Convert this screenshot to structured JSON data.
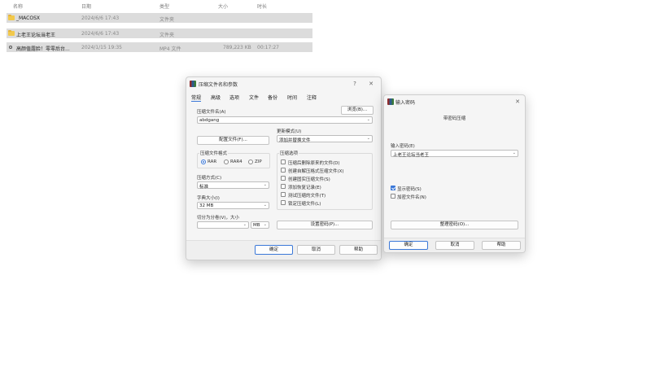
{
  "file_list": {
    "columns": {
      "name": "名称",
      "date": "日期",
      "type": "类型",
      "size": "大小",
      "duration": "时长"
    },
    "rows": [
      {
        "icon": "folder-icon",
        "name": "_MACOSX",
        "date": "2024/6/6 17:43",
        "type": "文件夹",
        "size": "",
        "duration": ""
      },
      {
        "icon": "folder-icon",
        "name": "上老王论坛当老王",
        "date": "2024/6/6 17:43",
        "type": "文件夹",
        "size": "",
        "duration": ""
      },
      {
        "icon": "media-icon",
        "name": "高颜值露脸！零零后台...",
        "date": "2024/1/15 19:35",
        "type": "MP4 文件",
        "size": "789,223 KB",
        "duration": "00:17:27"
      }
    ]
  },
  "archive_dialog": {
    "title": "压缩文件名和参数",
    "help_glyph": "?",
    "close_glyph": "✕",
    "tabs": [
      "常规",
      "高级",
      "选项",
      "文件",
      "备份",
      "时间",
      "注释"
    ],
    "archive_name_label": "压缩文件名(A)",
    "archive_name_value": "abdgang",
    "browse_label": "浏览(B)...",
    "update_mode_label": "更新模式(U)",
    "update_mode_value": "添加并替换文件",
    "profiles_label": "配置文件(F)...",
    "format_group": "压缩文件格式",
    "formats": [
      "RAR",
      "RAR4",
      "ZIP"
    ],
    "format_selected": "RAR",
    "method_label": "压缩方式(C)",
    "method_value": "标准",
    "dict_label": "字典大小(I)",
    "dict_value": "32 MB",
    "split_label": "切分为分卷(V)，大小",
    "split_value": "",
    "split_unit": "MB",
    "options_group": "压缩选项",
    "options": [
      {
        "label": "压缩后删除原来的文件(D)",
        "checked": false
      },
      {
        "label": "创建自解压格式压缩文件(X)",
        "checked": false
      },
      {
        "label": "创建固实压缩文件(S)",
        "checked": false
      },
      {
        "label": "添加恢复记录(E)",
        "checked": false
      },
      {
        "label": "测试压缩的文件(T)",
        "checked": false
      },
      {
        "label": "锁定压缩文件(L)",
        "checked": false
      }
    ],
    "set_password_label": "设置密码(P)...",
    "ok_label": "确定",
    "cancel_label": "取消",
    "help_label": "帮助"
  },
  "password_dialog": {
    "title": "输入密码",
    "close_glyph": "✕",
    "subtitle": "带密码压缩",
    "password_label": "输入密码(E)",
    "password_value": "上老王论坛当老王",
    "show_password_label": "显示密码(S)",
    "show_password_checked": true,
    "encrypt_names_label": "加密文件名(N)",
    "encrypt_names_checked": false,
    "organize_label": "整理密码(O)...",
    "ok_label": "确定",
    "cancel_label": "取消",
    "help_label": "帮助"
  },
  "colors": {
    "accent": "#3b78d8",
    "row_highlight": "#dcdcdc",
    "folder": "#f2c94c",
    "dialog_bg": "#f5f5f5"
  }
}
